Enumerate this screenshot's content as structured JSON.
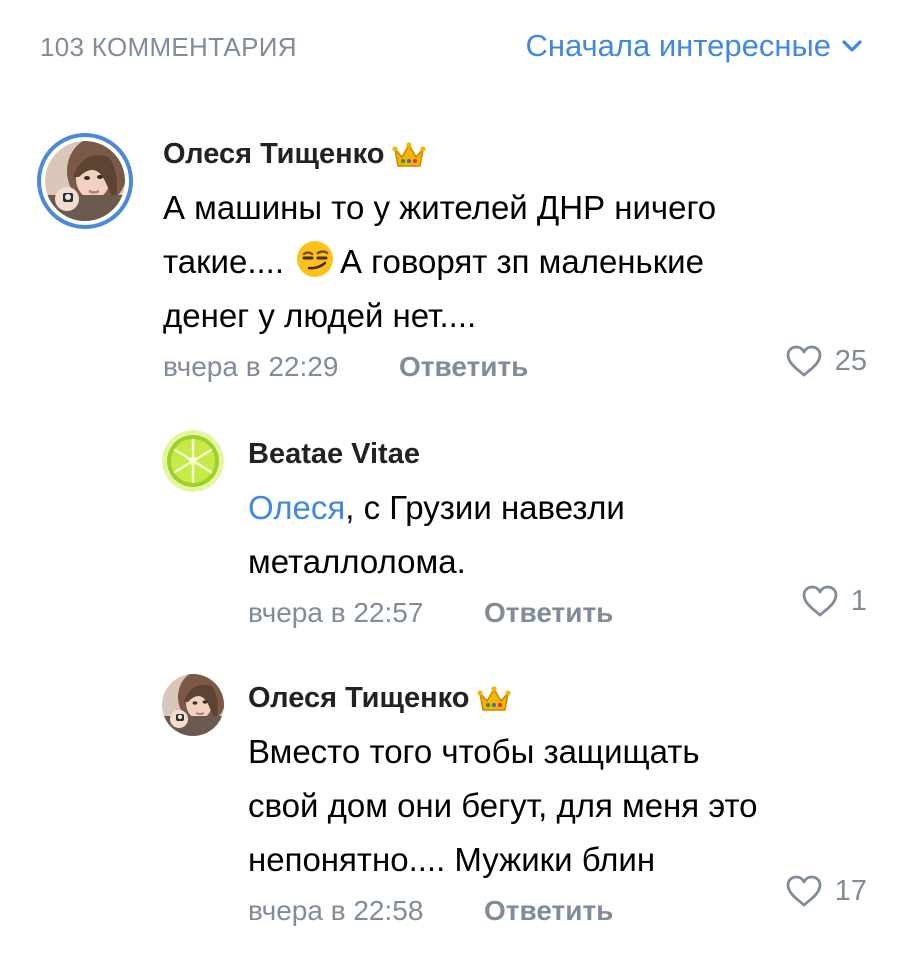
{
  "header": {
    "count_label": "103 КОММЕНТАРИЯ",
    "sort_label": "Сначала интересные",
    "sort_icon": "chevron-down-icon"
  },
  "colors": {
    "accent": "#3f8ae0",
    "secondary_text": "#818c99",
    "story_ring": "#4a8ad8",
    "crown": "#f4b400"
  },
  "comments": [
    {
      "author": "Олеся Тищенко",
      "badge_icon": "crown-icon",
      "text_lines": [
        "А машины то у жителей ДНР ничего",
        "такие....",
        "А говорят зп маленькие",
        "денег у людей нет...."
      ],
      "emoji": "smirking-face-emoji",
      "date": "вчера в 22:29",
      "reply_label": "Ответить",
      "likes": "25"
    },
    {
      "author": "Beatae Vitae",
      "mention": "Олеся",
      "text_after_mention": ", с Грузии навезли",
      "text_line2": "металлолома.",
      "date": "вчера в 22:57",
      "reply_label": "Ответить",
      "likes": "1"
    },
    {
      "author": "Олеся Тищенко",
      "badge_icon": "crown-icon",
      "text_lines": [
        "Вместо того чтобы защищать",
        "свой дом они бегут, для меня это",
        "непонятно.... Мужики блин"
      ],
      "date": "вчера в 22:58",
      "reply_label": "Ответить",
      "likes": "17"
    }
  ]
}
